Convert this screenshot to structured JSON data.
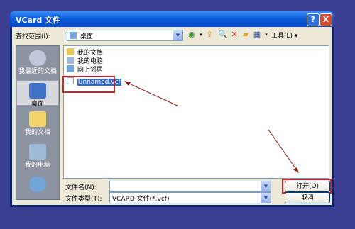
{
  "window": {
    "title": "VCard 文件",
    "help_label": "?",
    "close_label": "X"
  },
  "lookin": {
    "label": "查找范围(I):",
    "value": "桌面"
  },
  "toolbar": {
    "tools_label": "工具(L)"
  },
  "places": [
    {
      "label": "我最近的文档"
    },
    {
      "label": "桌面"
    },
    {
      "label": "我的文档"
    },
    {
      "label": "我的电脑"
    }
  ],
  "files": [
    {
      "name": "我的文档"
    },
    {
      "name": "我的电脑"
    },
    {
      "name": "网上邻居"
    },
    {
      "name": "Unnamed.vcf"
    }
  ],
  "filename": {
    "label": "文件名(N):",
    "value": ""
  },
  "filetype": {
    "label": "文件类型(T):",
    "value": "VCARD 文件(*.vcf)"
  },
  "buttons": {
    "open": "打开(O)",
    "cancel": "取消"
  },
  "colors": {
    "highlight_red": "#c0272d",
    "arrow_red": "#8b1a1a",
    "selection_blue": "#316ac5"
  }
}
